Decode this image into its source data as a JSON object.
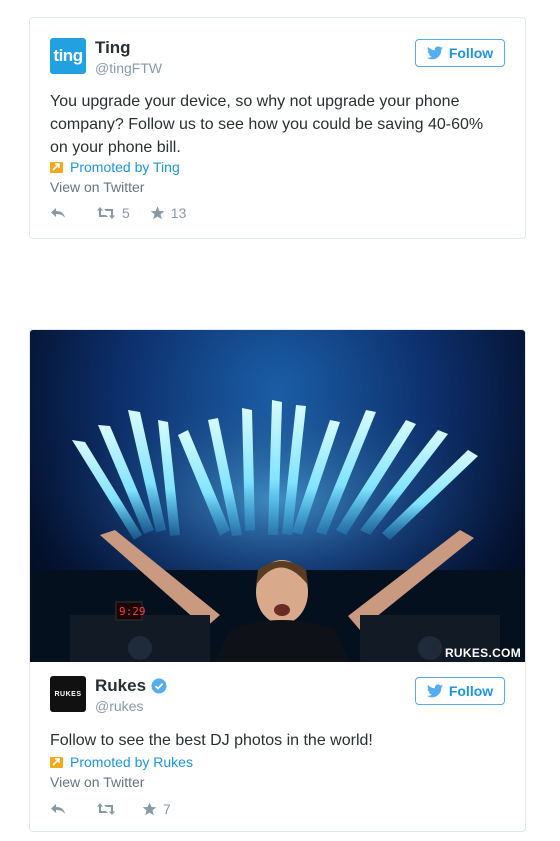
{
  "colors": {
    "twitter_blue": "#55acee",
    "promo_orange": "#f2a91b",
    "ting_blue": "#21a1e1"
  },
  "tweets": [
    {
      "avatar_text": "ting",
      "display_name": "Ting",
      "handle": "@tingFTW",
      "follow_label": "Follow",
      "text": "You upgrade your device, so why not upgrade your phone company? Follow us to see how you could be saving 40-60% on your phone bill.",
      "promoted": "Promoted by Ting",
      "view_on": "View on Twitter",
      "retweets": "5",
      "favorites": "13"
    },
    {
      "avatar_text": "RUKES",
      "display_name": "Rukes",
      "handle": "@rukes",
      "verified": true,
      "follow_label": "Follow",
      "text": "Follow to see the best DJ photos in the world!",
      "promoted": "Promoted by Rukes",
      "view_on": "View on Twitter",
      "retweets": "",
      "favorites": "7",
      "image_watermark": "RUKES.COM",
      "image_clock": "9:29"
    }
  ],
  "icons": [
    "reply-icon",
    "retweet-icon",
    "favorite-icon",
    "twitter-bird-icon",
    "verified-icon",
    "promoted-icon"
  ]
}
